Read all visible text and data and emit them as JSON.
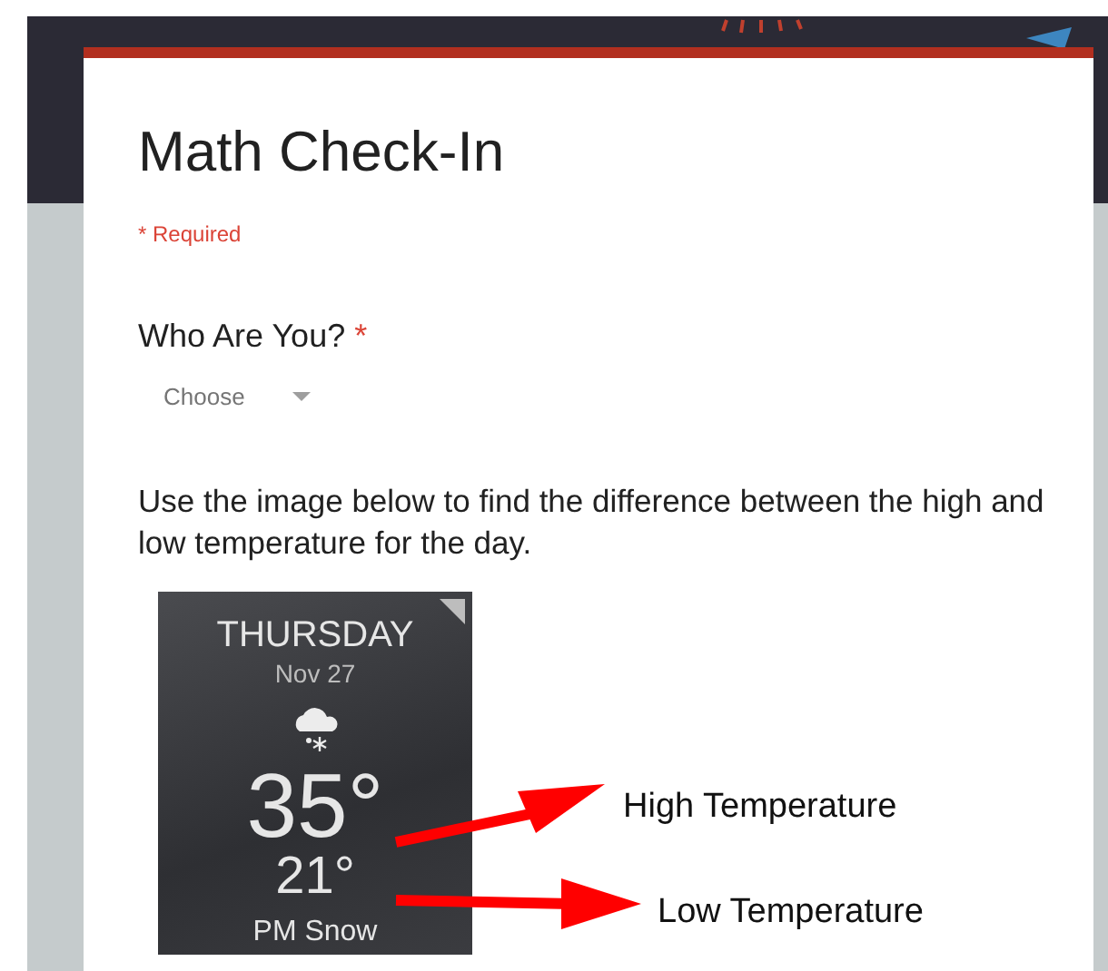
{
  "form": {
    "title": "Math Check-In",
    "required_note": "* Required",
    "questions": [
      {
        "kind": "dropdown",
        "label": "Who Are You?",
        "required_mark": "*",
        "placeholder": "Choose"
      }
    ],
    "instructions": "Use the image below to find the difference between the high and low temperature for the day.",
    "image": {
      "day": "THURSDAY",
      "date": "Nov 27",
      "high": "35°",
      "low": "21°",
      "condition": "PM Snow",
      "annotations": [
        {
          "label": "High Temperature"
        },
        {
          "label": "Low Temperature"
        }
      ]
    }
  }
}
